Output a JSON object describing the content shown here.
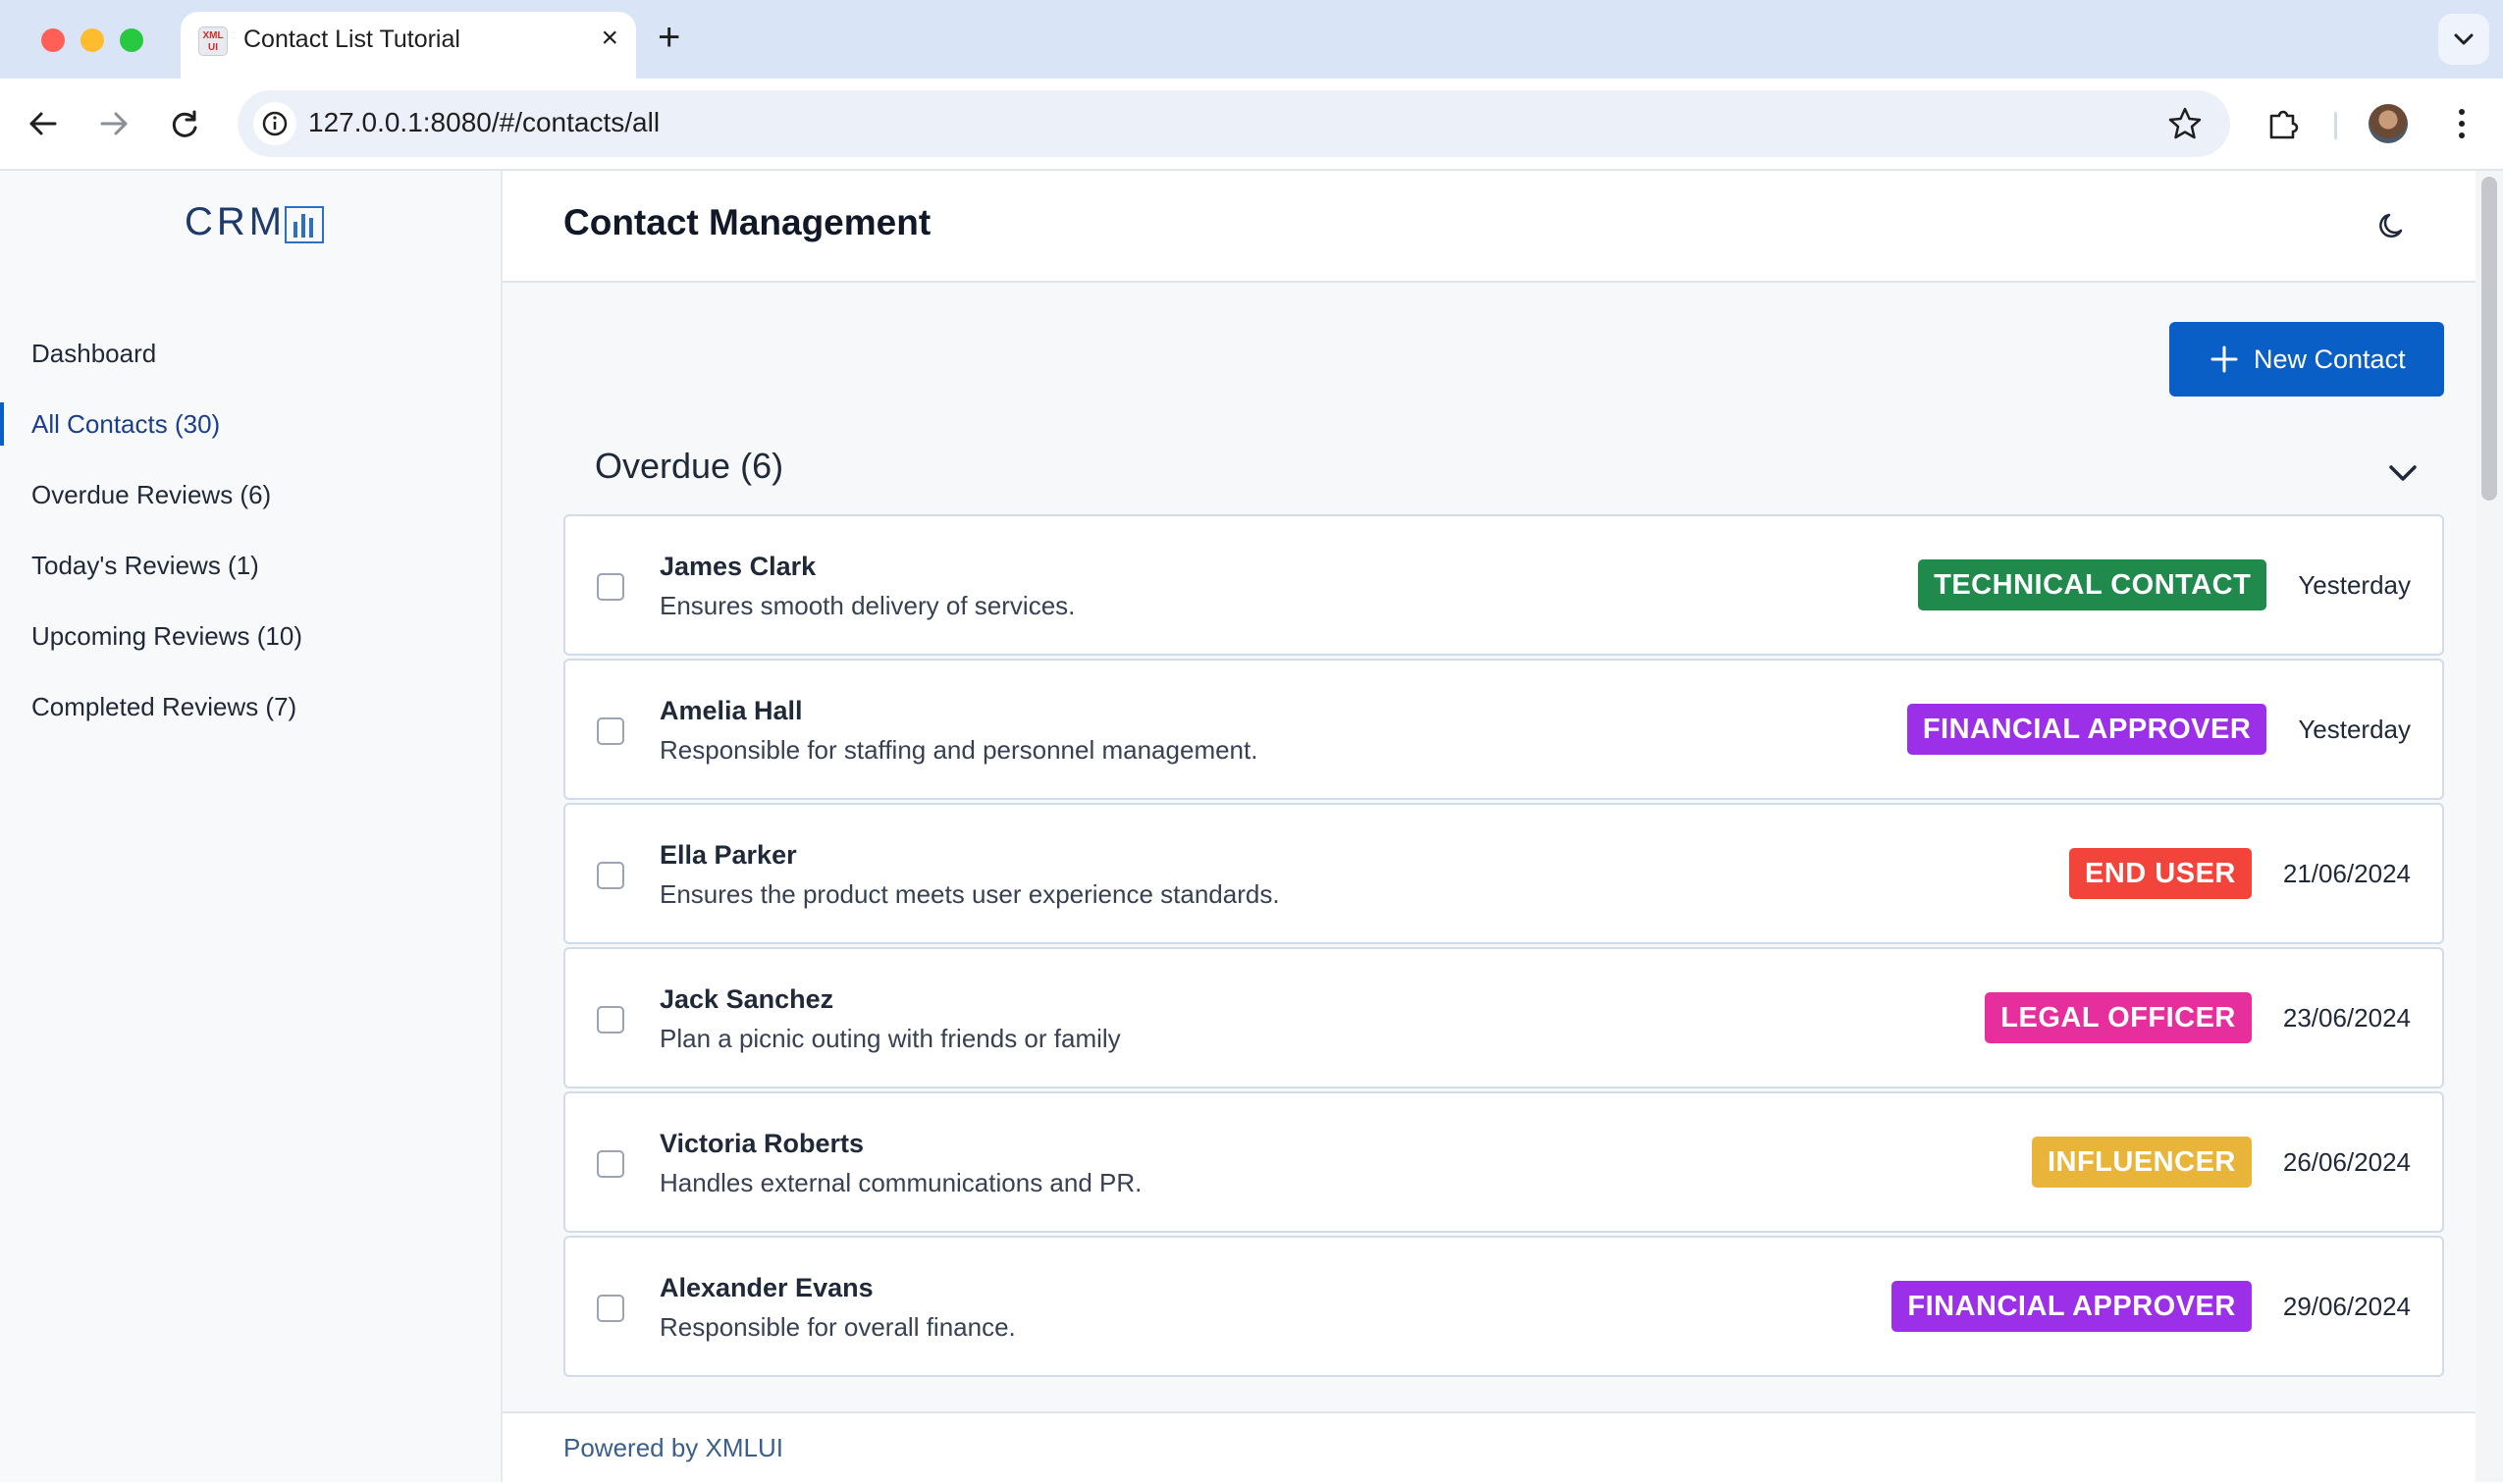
{
  "browser": {
    "tab_title": "Contact List Tutorial",
    "favicon_text": "XML UI",
    "url": "127.0.0.1:8080/#/contacts/all"
  },
  "app": {
    "logo_text": "CRM",
    "page_title": "Contact Management",
    "accent_color": "#0a5fc7",
    "footer_text": "Powered by XMLUI"
  },
  "sidebar": {
    "items": [
      {
        "label": "Dashboard",
        "active": false
      },
      {
        "label": "All Contacts (30)",
        "active": true
      },
      {
        "label": "Overdue Reviews (6)",
        "active": false
      },
      {
        "label": "Today's Reviews (1)",
        "active": false
      },
      {
        "label": "Upcoming Reviews (10)",
        "active": false
      },
      {
        "label": "Completed Reviews (7)",
        "active": false
      }
    ]
  },
  "toolbar": {
    "new_contact_label": "New Contact"
  },
  "section": {
    "title": "Overdue (6)"
  },
  "contacts": [
    {
      "name": "James Clark",
      "description": "Ensures smooth delivery of services.",
      "tag": "TECHNICAL CONTACT",
      "tag_color": "#1f8a4c",
      "date": "Yesterday"
    },
    {
      "name": "Amelia Hall",
      "description": "Responsible for staffing and personnel management.",
      "tag": "FINANCIAL APPROVER",
      "tag_color": "#9b30e8",
      "date": "Yesterday"
    },
    {
      "name": "Ella Parker",
      "description": "Ensures the product meets user experience standards.",
      "tag": "END USER",
      "tag_color": "#f2443a",
      "date": "21/06/2024"
    },
    {
      "name": "Jack Sanchez",
      "description": "Plan a picnic outing with friends or family",
      "tag": "LEGAL OFFICER",
      "tag_color": "#e62e9c",
      "date": "23/06/2024"
    },
    {
      "name": "Victoria Roberts",
      "description": "Handles external communications and PR.",
      "tag": "INFLUENCER",
      "tag_color": "#e8b53a",
      "date": "26/06/2024"
    },
    {
      "name": "Alexander Evans",
      "description": "Responsible for overall finance.",
      "tag": "FINANCIAL APPROVER",
      "tag_color": "#9b30e8",
      "date": "29/06/2024"
    }
  ]
}
